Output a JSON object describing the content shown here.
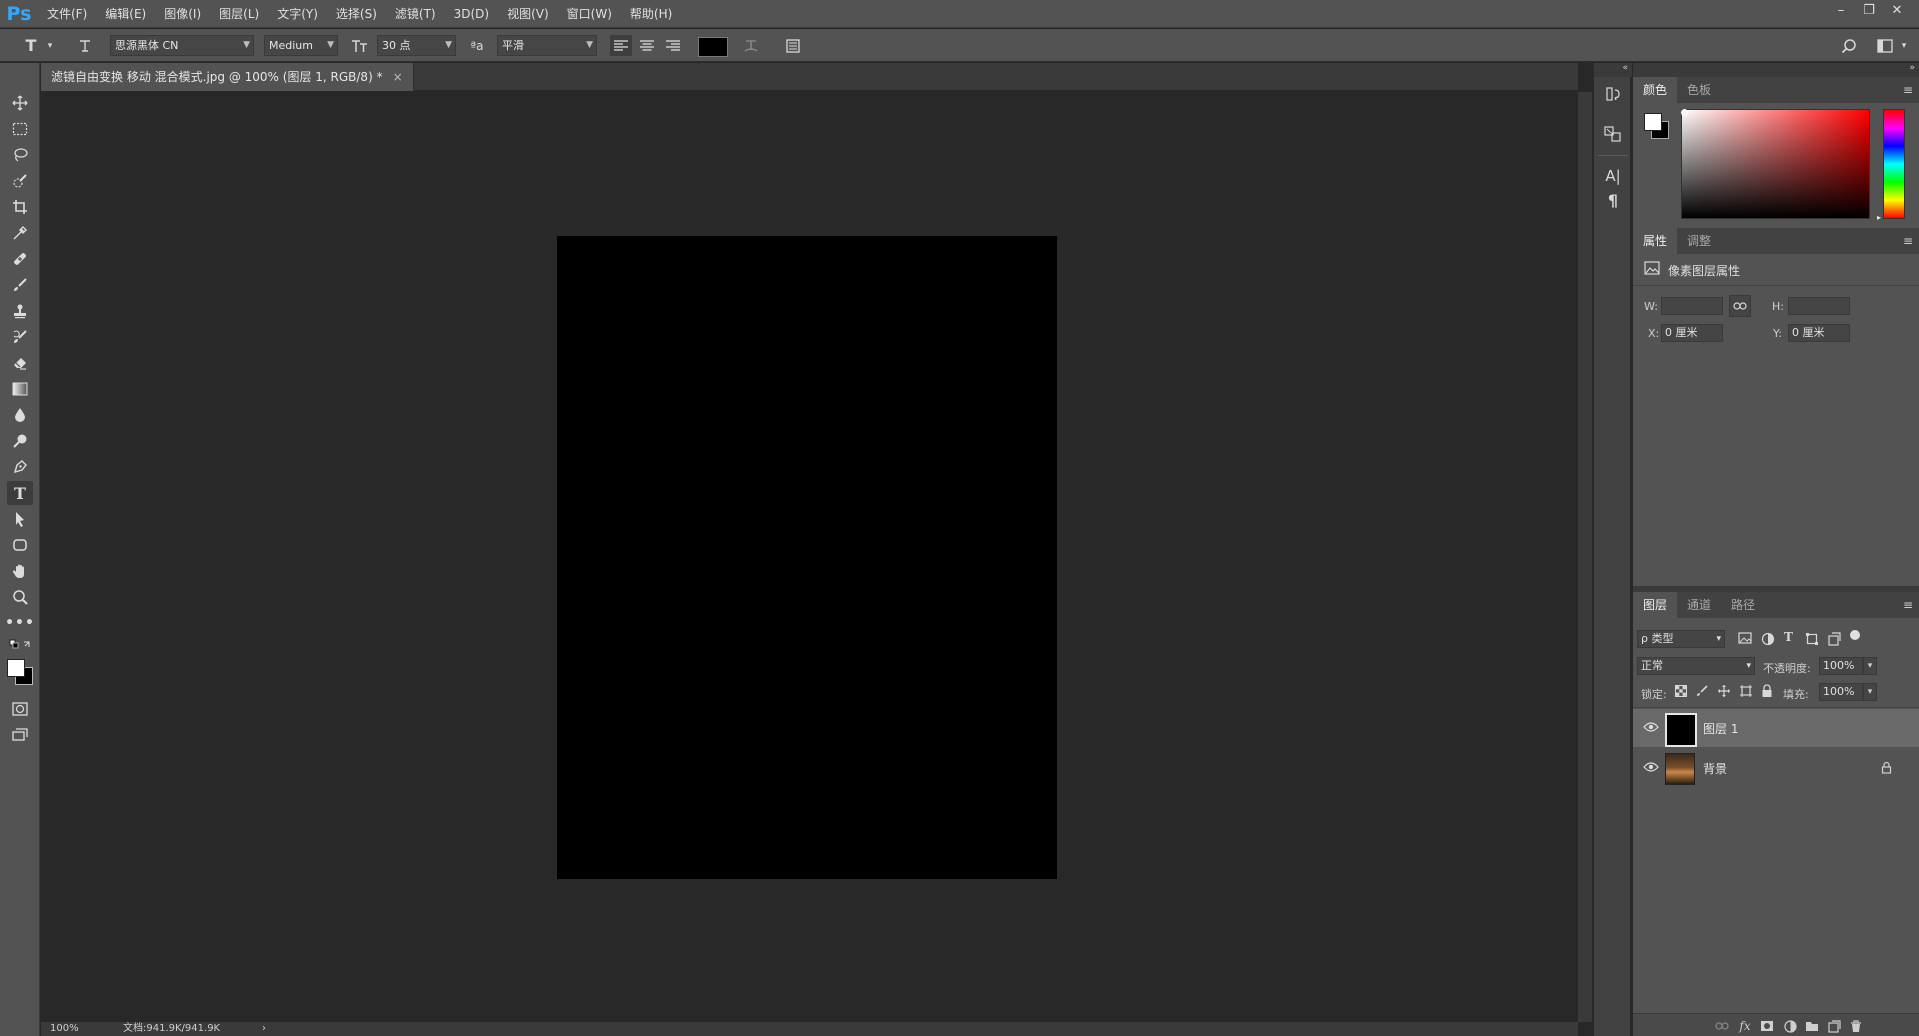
{
  "app": {
    "logo": "Ps"
  },
  "menu": [
    "文件(F)",
    "编辑(E)",
    "图像(I)",
    "图层(L)",
    "文字(Y)",
    "选择(S)",
    "滤镜(T)",
    "3D(D)",
    "视图(V)",
    "窗口(W)",
    "帮助(H)"
  ],
  "window_controls": {
    "minimize": "–",
    "restore": "❐",
    "close": "✕"
  },
  "options_bar": {
    "tool_icon": "T",
    "font_family": "思源黑体 CN",
    "font_style": "Medium",
    "font_size": "30 点",
    "aa_label": "ªa",
    "antialias": "平滑",
    "text_color": "#000000"
  },
  "document": {
    "tab_title": "滤镜自由变换 移动 混合模式.jpg @ 100% (图层 1, RGB/8) *",
    "close": "×",
    "canvas_color": "#000000"
  },
  "status": {
    "zoom": "100%",
    "doc_size": "文档:941.9K/941.9K",
    "arrow": "›"
  },
  "panels": {
    "color": {
      "tabs": [
        "颜色",
        "色板"
      ],
      "menu": "≡",
      "fg": "#ffffff",
      "bg": "#000000"
    },
    "properties": {
      "tabs": [
        "属性",
        "调整"
      ],
      "menu": "≡",
      "heading": "像素图层属性",
      "w_label": "W:",
      "h_label": "H:",
      "x_label": "X:",
      "x_value": "0 厘米",
      "y_label": "Y:",
      "y_value": "0 厘米"
    },
    "layers": {
      "tabs": [
        "图层",
        "通道",
        "路径"
      ],
      "menu": "≡",
      "filter_kind": "ρ 类型",
      "blend_mode": "正常",
      "opacity_label": "不透明度:",
      "opacity": "100%",
      "lock_label": "锁定:",
      "fill_label": "填充:",
      "fill": "100%",
      "items": [
        {
          "name": "图层 1",
          "selected": true,
          "locked": false
        },
        {
          "name": "背景",
          "selected": false,
          "locked": true
        }
      ]
    }
  },
  "accent": "#31a8ff"
}
